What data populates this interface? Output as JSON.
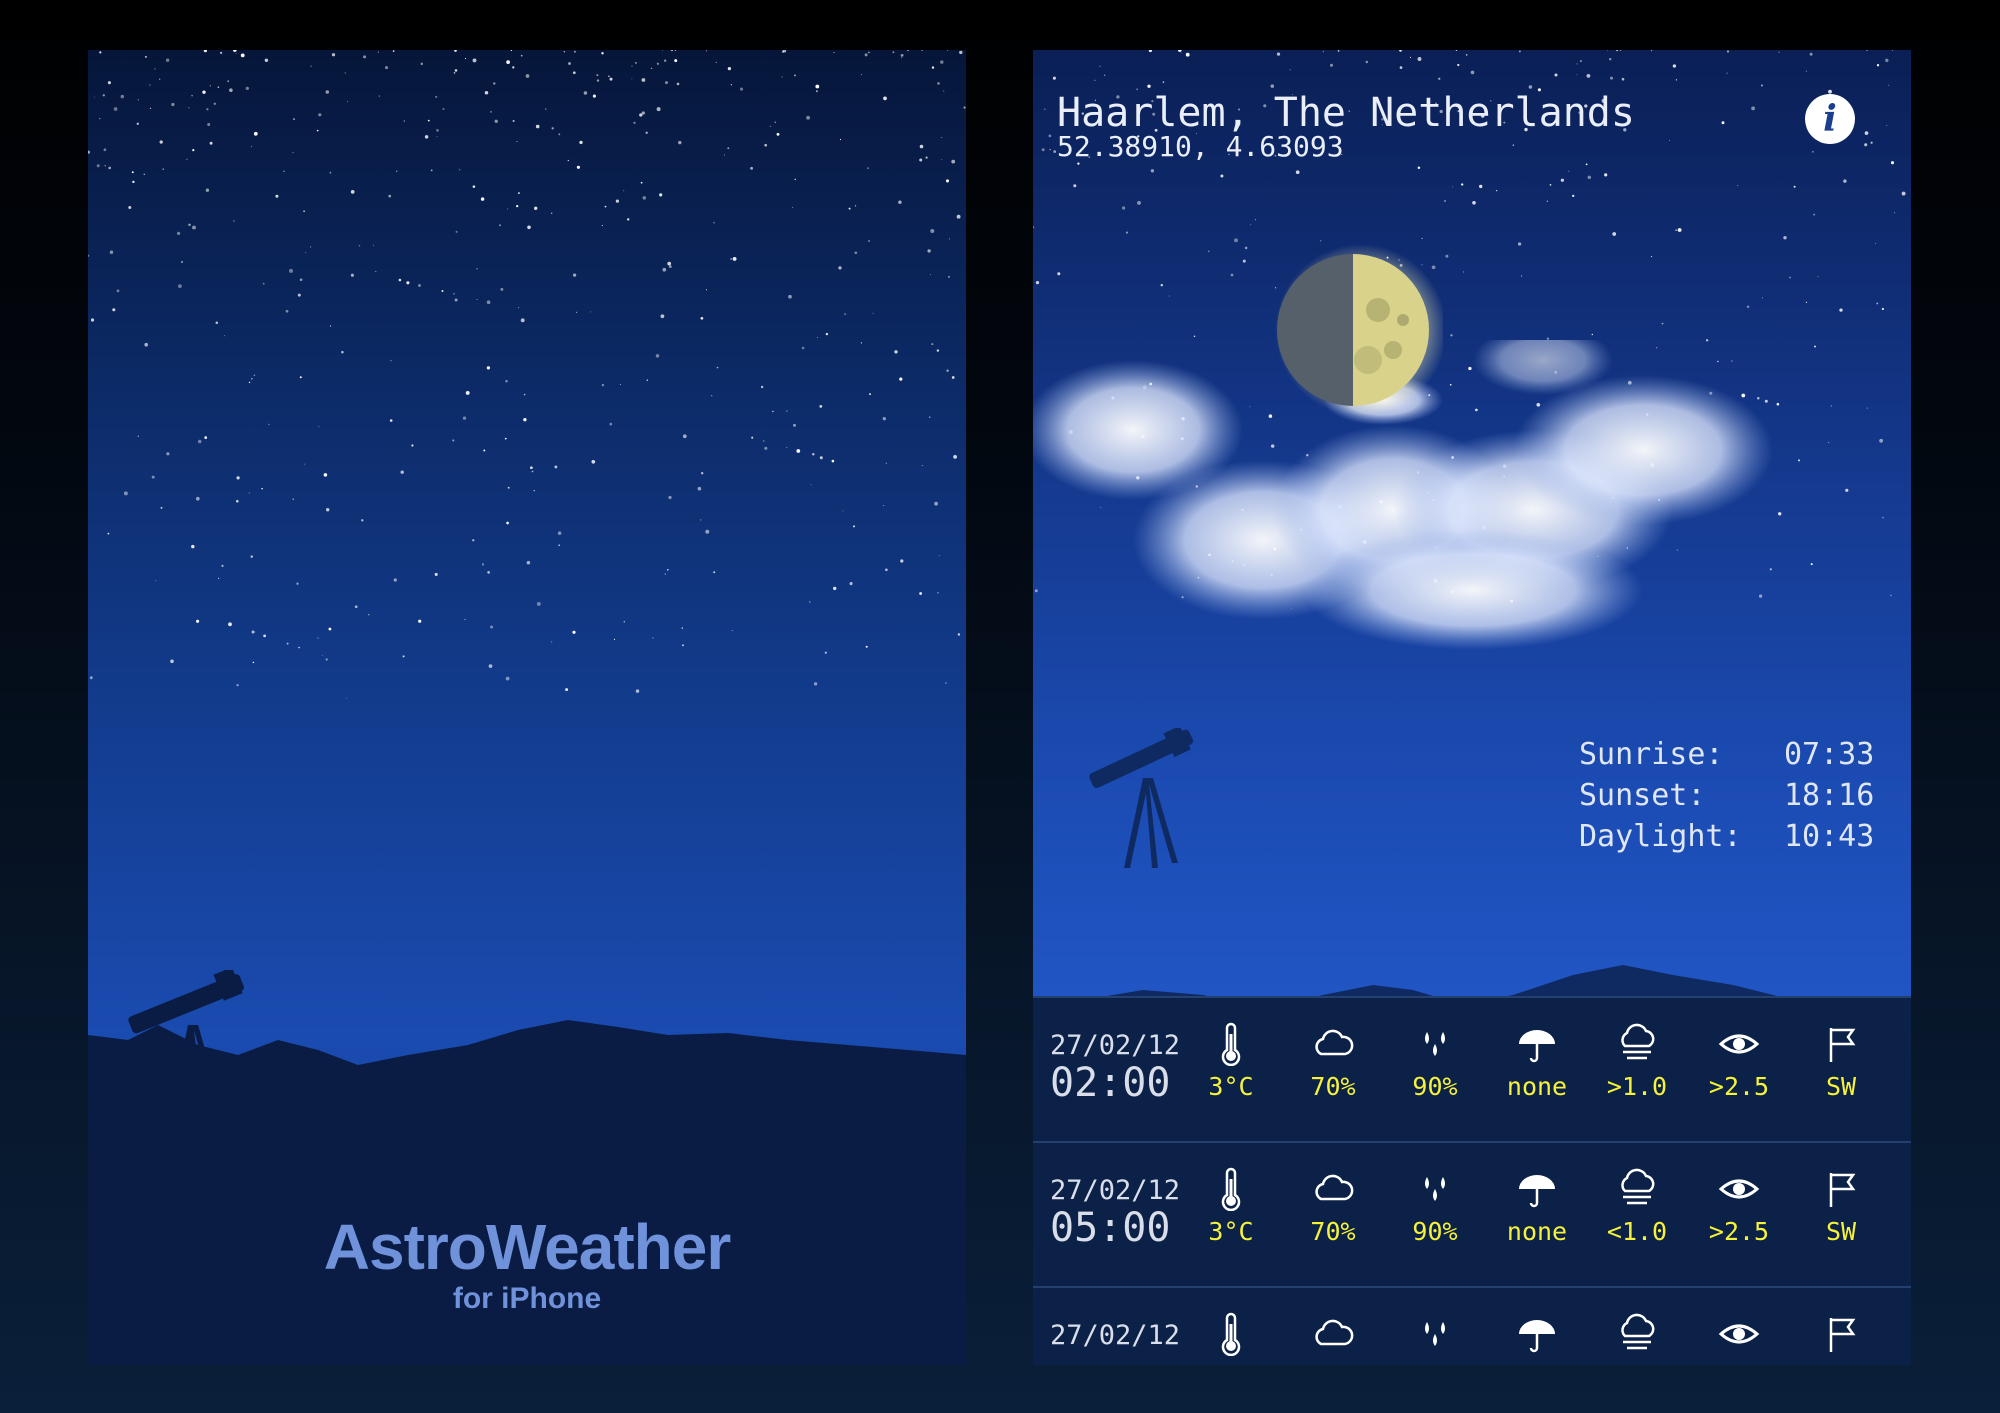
{
  "splash": {
    "brand_title": "AstroWeather",
    "brand_subtitle": "for iPhone"
  },
  "main": {
    "location_name": "Haarlem, The Netherlands",
    "coordinates": "52.38910, 4.63093",
    "info_icon": "info-icon",
    "sun": [
      {
        "label": "Sunrise:",
        "value": "07:33"
      },
      {
        "label": "Sunset:",
        "value": "18:16"
      },
      {
        "label": "Daylight:",
        "value": "10:43"
      }
    ],
    "forecast": [
      {
        "date": "27/02/12",
        "time": "02:00",
        "values": [
          "3°C",
          "70%",
          "90%",
          "none",
          ">1.0",
          ">2.5",
          "SW"
        ]
      },
      {
        "date": "27/02/12",
        "time": "05:00",
        "values": [
          "3°C",
          "70%",
          "90%",
          "none",
          "<1.0",
          ">2.5",
          "SW"
        ]
      },
      {
        "date": "27/02/12",
        "time": "",
        "values": [
          "",
          "",
          "",
          "",
          "",
          "",
          ""
        ]
      }
    ],
    "columns": [
      "thermometer-icon",
      "cloud-icon",
      "humidity-icon",
      "umbrella-icon",
      "seeing-icon",
      "eye-icon",
      "flag-icon"
    ]
  },
  "colors": {
    "value_yellow": "#f6f23a",
    "sky_blue": "#1b4bb2",
    "hills_dark": "#0b2147",
    "brand_blue": "#6f92db"
  }
}
